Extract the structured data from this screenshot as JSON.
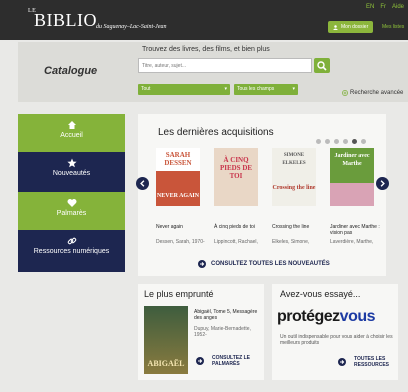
{
  "header": {
    "logo": {
      "prefix": "LE",
      "name": "BIBLIO",
      "region": "du Saguenay–Lac-Saint-Jean"
    },
    "top_links": [
      "EN",
      "Fr",
      "Aide"
    ],
    "account_label": "Mon dossier",
    "lists_label": "Mes listes"
  },
  "catalog": {
    "title": "Catalogue",
    "prompt": "Trouvez des livres, des films, et bien plus",
    "search_placeholder": "Titre, auteur, sujet...",
    "type_select": "Tout",
    "field_select": "Tous les champs",
    "advanced_search": "Recherche avancée"
  },
  "sidebar": {
    "items": [
      {
        "label": "Accueil",
        "icon": "home-icon"
      },
      {
        "label": "Nouveautés",
        "icon": "star-icon"
      },
      {
        "label": "Palmarès",
        "icon": "heart-icon"
      },
      {
        "label": "Ressources numériques",
        "icon": "link-icon"
      }
    ]
  },
  "acquisitions": {
    "title": "Les dernières acquisitions",
    "books": [
      {
        "title": "Never again",
        "author": "Dessen, Sarah, 1970-",
        "cover_text": "SARAH DESSEN",
        "cover_sub": "NEVER AGAIN"
      },
      {
        "title": "À cinq pieds de toi",
        "author": "Lippincott, Rachael,",
        "cover_text": "À CINQ PIEDS DE TOI",
        "cover_sub": ""
      },
      {
        "title": "Crossing the line",
        "author": "Elkeles, Simone,",
        "cover_text": "SIMONE ELKELES",
        "cover_sub": "Crossing the line"
      },
      {
        "title": "Jardiner avec Marthe : vision pas",
        "author": "Laverdière, Marthe,",
        "cover_text": "Jardiner avec Marthe",
        "cover_sub": ""
      }
    ],
    "see_all": "CONSULTEZ TOUTES LES NOUVEAUTÉS",
    "dot_count": 6,
    "active_dot": 4
  },
  "popular": {
    "title": "Le plus emprunté",
    "book_title": "Abigaël, Tome 5, Messagère des anges",
    "book_author": "Dupuy, Marie-Bernadette, 1952-",
    "cover_text": "ABIGAËL",
    "link": "CONSULTEZ LE PALMARÈS"
  },
  "tried": {
    "title": "Avez-vous essayé...",
    "logo_part1": "protégez",
    "logo_part2": "vous",
    "description": "Un outil indispensable pour vous aider à choisir les meilleurs produits",
    "link": "TOUTES LES RESSOURCES"
  },
  "colors": {
    "green": "#85b33a",
    "navy": "#1d2650",
    "topbar": "#2d2d2d"
  }
}
